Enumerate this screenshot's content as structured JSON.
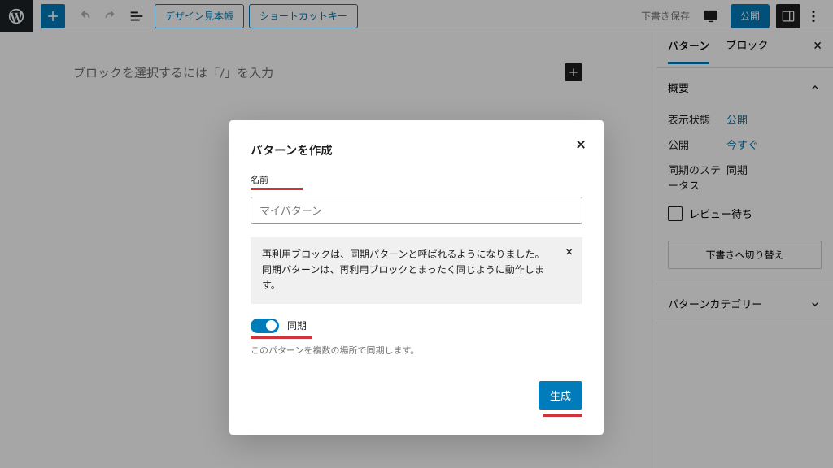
{
  "toolbar": {
    "design_btn": "デザイン見本帳",
    "shortcut_btn": "ショートカットキー",
    "draft_save": "下書き保存",
    "publish": "公開"
  },
  "editor": {
    "placeholder": "ブロックを選択するには「/」を入力"
  },
  "sidebar": {
    "tabs": {
      "pattern": "パターン",
      "block": "ブロック"
    },
    "overview": "概要",
    "rows": {
      "visibility_label": "表示状態",
      "visibility_value": "公開",
      "publish_label": "公開",
      "publish_value": "今すぐ",
      "sync_label": "同期のステータス",
      "sync_value": "同期"
    },
    "review": "レビュー待ち",
    "switch_draft": "下書きへ切り替え",
    "categories": "パターンカテゴリー"
  },
  "modal": {
    "title": "パターンを作成",
    "name_label": "名前",
    "name_placeholder": "マイパターン",
    "notice": "再利用ブロックは、同期パターンと呼ばれるようになりました。同期パターンは、再利用ブロックとまったく同じように動作します。",
    "sync_label": "同期",
    "sync_help": "このパターンを複数の場所で同期します。",
    "generate": "生成"
  }
}
